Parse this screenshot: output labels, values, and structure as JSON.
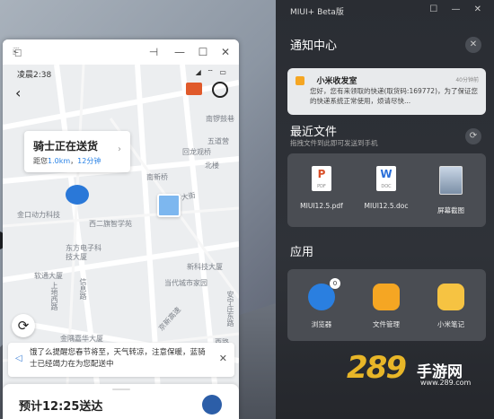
{
  "phone": {
    "status_time": "凌晨2:38",
    "status_icons": "◢ ⌔ ▭",
    "rider_card": {
      "title": "骑士正在送货",
      "distance_prefix": "距您",
      "distance_value": "1.0km",
      "separator": "，",
      "minutes": "12分钟"
    },
    "map_labels": {
      "nannluogu": "南锣鼓巷",
      "wudaoying": "五道营",
      "yudingguan": "回龙观桥",
      "beilou": "北楼",
      "nanxinqiao": "南新桥",
      "xierhuan": "西二环大街",
      "jindong": "金口动力科技",
      "xierqi": "西二旗智学苑",
      "dongfang": "东方电子科技大厦",
      "ruantong": "软通大厦",
      "xinkeji": "新科技大厦",
      "dangdai": "当代城市家园",
      "shangdi": "上地西路",
      "xinqiao": "信息路",
      "jingxin": "京新高速",
      "shangdidong": "上地东路",
      "jinhai": "金隅嘉华大厦",
      "anningzhuang": "安宁庄东路",
      "xiwu": "西路",
      "shanghe": "上地七"
    },
    "notice": "饿了么提醒您春节将至，天气转凉，注意保暖，蓝骑士已经竭力在为您配送中",
    "eta": "预计12:25送达"
  },
  "panel": {
    "header": "MIUI+ Beta版",
    "header_icons": "☐ — ✕",
    "notif_title": "通知中心",
    "notification": {
      "app": "小米收发室",
      "time": "40分钟前",
      "body": "您好，您有来领取的快递(取货码:169772)，为了保证您的快递系统正常使用，烦请尽快..."
    },
    "recent_title": "最近文件",
    "recent_hint": "拖拽文件到此即可发送到手机",
    "files": [
      {
        "glyph": "P",
        "ext": "PDF",
        "name": "MIUI12.5.pdf",
        "color": "#d9502a"
      },
      {
        "glyph": "W",
        "ext": "DOC",
        "name": "MIUI12.5.doc",
        "color": "#2a6fd9"
      },
      {
        "glyph": "",
        "ext": "",
        "name": "屏幕截图",
        "color": ""
      }
    ],
    "apps_title": "应用",
    "apps": [
      {
        "name": "浏览器",
        "badge": "0",
        "color": "#2a7fe0"
      },
      {
        "name": "文件管理",
        "badge": "",
        "color": "#f5a623"
      },
      {
        "name": "小米笔记",
        "badge": "",
        "color": "#f6c342"
      }
    ]
  },
  "watermark": {
    "number": "289",
    "text": "手游网",
    "url": "www.289.com"
  }
}
